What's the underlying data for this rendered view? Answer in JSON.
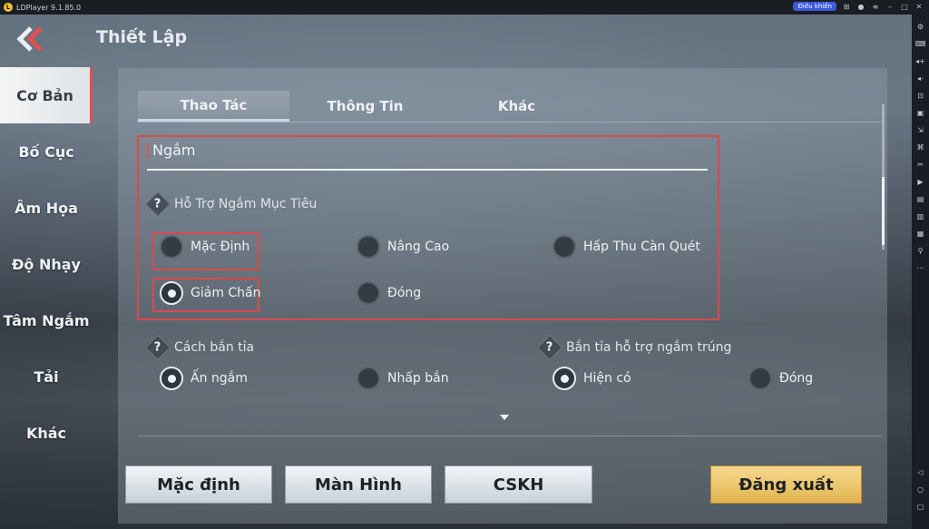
{
  "emulator": {
    "title": "LDPlayer 9.1.85.0",
    "control_button": "Điều khiển",
    "window_icons": [
      "gamepad-icon",
      "user-icon",
      "menu-icon",
      "minimize-icon",
      "maximize-icon",
      "close-icon"
    ],
    "sidebar_icons": [
      "settings-icon",
      "keyboard-icon",
      "volume-up-icon",
      "volume-down-icon",
      "screenshot-icon",
      "window-icon",
      "resize-icon",
      "shake-icon",
      "cut-icon",
      "record-icon",
      "folder-icon",
      "multi-icon",
      "apk-icon",
      "location-icon",
      "more-icon",
      "back-icon",
      "home-icon",
      "recent-icon"
    ]
  },
  "header": {
    "title": "Thiết Lập"
  },
  "sidenav": {
    "items": [
      {
        "label": "Cơ Bản",
        "active": true
      },
      {
        "label": "Bố Cục",
        "active": false
      },
      {
        "label": "Âm Họa",
        "active": false
      },
      {
        "label": "Độ Nhạy",
        "active": false
      },
      {
        "label": "Tâm Ngắm",
        "active": false
      },
      {
        "label": "Tải",
        "active": false
      },
      {
        "label": "Khác",
        "active": false
      }
    ]
  },
  "tabs": [
    {
      "label": "Thao Tác",
      "active": true
    },
    {
      "label": "Thông Tin",
      "active": false
    },
    {
      "label": "Khác",
      "active": false
    }
  ],
  "aim_section": {
    "heading": "Ngắm",
    "question": "Hỗ Trợ Ngắm Mục Tiêu",
    "options": [
      {
        "label": "Mặc Định",
        "selected": false
      },
      {
        "label": "Nâng Cao",
        "selected": false
      },
      {
        "label": "Hấp Thu Càn Quét",
        "selected": false
      },
      {
        "label": "Giảm Chấn",
        "selected": true
      },
      {
        "label": "Đóng",
        "selected": false
      }
    ]
  },
  "fire_section": {
    "question": "Cách bắn tỉa",
    "options": [
      {
        "label": "Ấn ngắm",
        "selected": true
      },
      {
        "label": "Nhấp bắn",
        "selected": false
      }
    ]
  },
  "assist_section": {
    "question": "Bắn tỉa hỗ trợ ngắm trúng",
    "options": [
      {
        "label": "Hiện có",
        "selected": true
      },
      {
        "label": "Đóng",
        "selected": false
      }
    ]
  },
  "buttons": {
    "default": "Mặc định",
    "screen": "Màn Hình",
    "support": "CSKH",
    "logout": "Đăng xuất"
  },
  "colors": {
    "highlight_red": "#d94a4a",
    "logout_gold": "#e2b44f",
    "control_blue": "#3b5bdb"
  }
}
